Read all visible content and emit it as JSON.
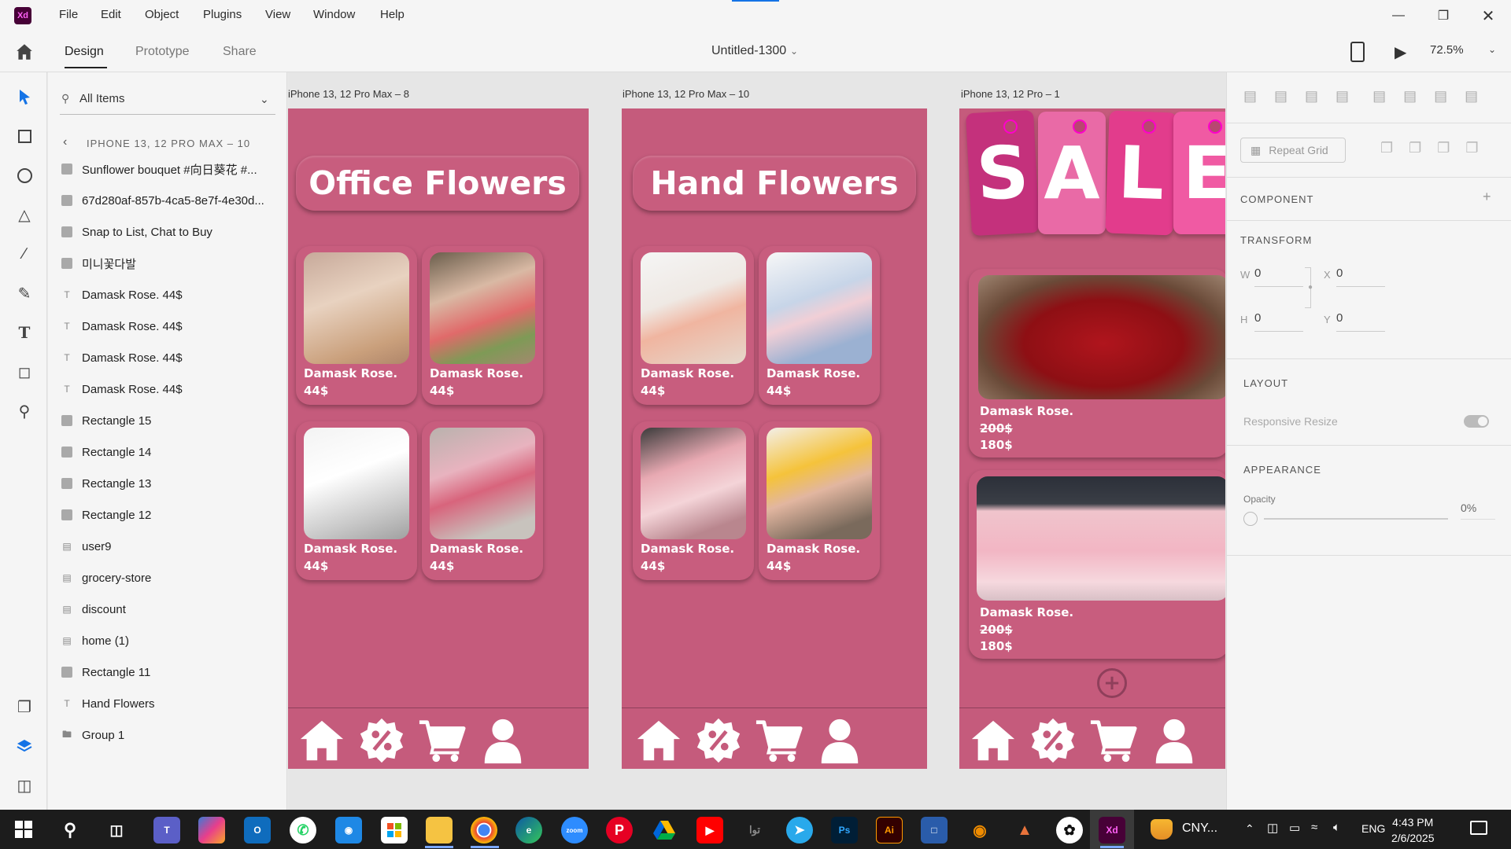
{
  "app": {
    "logo": "Xd",
    "menu": [
      "File",
      "Edit",
      "Object",
      "Plugins",
      "View",
      "Window",
      "Help"
    ]
  },
  "toolbar": {
    "tabs": [
      "Design",
      "Prototype",
      "Share"
    ],
    "doc_title": "Untitled-1300",
    "zoom": "72.5%"
  },
  "layers": {
    "search_label": "All Items",
    "breadcrumb": "IPHONE 13, 12 PRO MAX – 10",
    "items": [
      {
        "label": "Sunflower bouquet  #向日葵花 #...",
        "icon": "rect"
      },
      {
        "label": "67d280af-857b-4ca5-8e7f-4e30d...",
        "icon": "rect"
      },
      {
        "label": "Snap to List, Chat to Buy",
        "icon": "rect"
      },
      {
        "label": "미니꽃다발",
        "icon": "rect"
      },
      {
        "label": "Damask Rose. 44$",
        "icon": "text"
      },
      {
        "label": "Damask Rose. 44$",
        "icon": "text"
      },
      {
        "label": "Damask Rose. 44$",
        "icon": "text"
      },
      {
        "label": "Damask Rose. 44$",
        "icon": "text"
      },
      {
        "label": "Rectangle 15",
        "icon": "rect"
      },
      {
        "label": "Rectangle 14",
        "icon": "rect"
      },
      {
        "label": "Rectangle 13",
        "icon": "rect"
      },
      {
        "label": "Rectangle 12",
        "icon": "rect"
      },
      {
        "label": "user9",
        "icon": "image"
      },
      {
        "label": "grocery-store",
        "icon": "image"
      },
      {
        "label": "discount",
        "icon": "image"
      },
      {
        "label": "home (1)",
        "icon": "image"
      },
      {
        "label": "Rectangle 11",
        "icon": "rect"
      },
      {
        "label": "Hand Flowers",
        "icon": "text"
      },
      {
        "label": "Group 1",
        "icon": "folder"
      }
    ]
  },
  "artboards": [
    {
      "label": "iPhone 13, 12 Pro Max – 8",
      "title": "Office Flowers",
      "cards": [
        {
          "name": "Damask Rose.",
          "price": "44$"
        },
        {
          "name": "Damask Rose.",
          "price": "44$"
        },
        {
          "name": "Damask Rose.",
          "price": "44$"
        },
        {
          "name": "Damask Rose.",
          "price": "44$"
        }
      ]
    },
    {
      "label": "iPhone 13, 12 Pro Max – 10",
      "title": "Hand Flowers",
      "cards": [
        {
          "name": "Damask Rose.",
          "price": "44$"
        },
        {
          "name": "Damask Rose.",
          "price": "44$"
        },
        {
          "name": "Damask Rose.",
          "price": "44$"
        },
        {
          "name": "Damask Rose.",
          "price": "44$"
        }
      ]
    },
    {
      "label": "iPhone 13, 12 Pro – 1",
      "sale_letters": [
        "S",
        "A",
        "L",
        "E"
      ],
      "cards": [
        {
          "name": "Damask Rose.",
          "old_price": "200$",
          "price": "180$"
        },
        {
          "name": "Damask Rose.",
          "old_price": "200$",
          "price": "180$"
        }
      ]
    }
  ],
  "props": {
    "repeat_grid": "Repeat Grid",
    "component": "COMPONENT",
    "transform": "TRANSFORM",
    "w_label": "W",
    "w": "0",
    "x_label": "X",
    "x": "0",
    "h_label": "H",
    "h": "0",
    "y_label": "Y",
    "y": "0",
    "layout": "LAYOUT",
    "responsive": "Responsive Resize",
    "appearance": "APPEARANCE",
    "opacity_label": "Opacity",
    "opacity": "0%"
  },
  "taskbar": {
    "time": "4:43 PM",
    "date": "2/6/2025",
    "lang": "ENG",
    "currency": "CNY..."
  },
  "colors": {
    "artboard": "#c55b7c",
    "accent": "#1473e6"
  }
}
